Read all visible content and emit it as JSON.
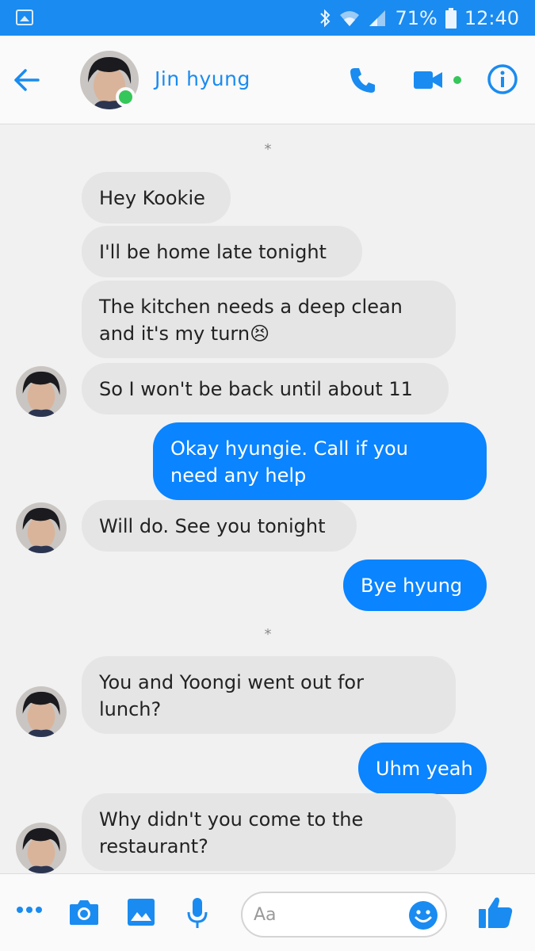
{
  "status_bar": {
    "battery_percent": "71%",
    "time": "12:40",
    "icons": [
      "gallery-icon",
      "bluetooth-icon",
      "wifi-icon",
      "signal-icon",
      "battery-icon"
    ]
  },
  "header": {
    "contact_name": "Jin hyung",
    "online": true,
    "icons": [
      "back-arrow-icon",
      "phone-icon",
      "video-camera-icon",
      "info-icon"
    ]
  },
  "messages": [
    {
      "id": "m1",
      "dir": "in",
      "lines": [
        "Hey Kookie"
      ]
    },
    {
      "id": "m2",
      "dir": "in",
      "lines": [
        "I'll be home late tonight"
      ]
    },
    {
      "id": "m3",
      "dir": "in",
      "lines": [
        "The kitchen needs a deep clean",
        "and it's my turn😣"
      ]
    },
    {
      "id": "m4",
      "dir": "in",
      "lines": [
        "So I won't be back until about 11"
      ]
    },
    {
      "id": "m5",
      "dir": "out",
      "lines": [
        "Okay hyungie. Call if you",
        "need any help"
      ]
    },
    {
      "id": "m6",
      "dir": "in",
      "lines": [
        "Will do. See you tonight"
      ]
    },
    {
      "id": "m7",
      "dir": "out",
      "lines": [
        "Bye hyung"
      ]
    },
    {
      "id": "m8",
      "dir": "in",
      "lines": [
        "You and Yoongi went out for",
        "lunch?"
      ]
    },
    {
      "id": "m9",
      "dir": "out",
      "lines": [
        "Uhm yeah"
      ]
    },
    {
      "id": "m10",
      "dir": "in",
      "lines": [
        "Why didn't you come to the",
        "restaurant?"
      ]
    }
  ],
  "dividers": [
    "*",
    "*"
  ],
  "composer": {
    "placeholder": "Aa",
    "icons": [
      "more-dots-icon",
      "camera-icon",
      "gallery-icon",
      "microphone-icon",
      "emoji-icon",
      "thumbs-up-icon"
    ]
  },
  "colors": {
    "brand_blue": "#1a8bf0",
    "outgoing_bubble": "#0a84ff",
    "incoming_bubble": "#e5e5e5",
    "online_green": "#35c759"
  }
}
